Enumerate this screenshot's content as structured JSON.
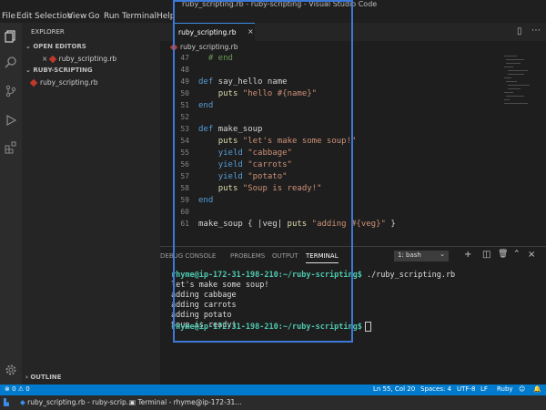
{
  "window": {
    "title": "ruby_scripting.rb - ruby-scripting - Visual Studio Code"
  },
  "menu": [
    "File",
    "Edit",
    "Selection",
    "View",
    "Go",
    "Run",
    "Terminal",
    "Help"
  ],
  "sidebar": {
    "explorer_label": "EXPLORER",
    "open_editors_label": "OPEN EDITORS",
    "open_editor_file": "ruby_scripting.rb",
    "folder_label": "RUBY-SCRIPTING",
    "folder_file": "ruby_scripting.rb",
    "outline_label": "OUTLINE"
  },
  "editor": {
    "tab_label": "ruby_scripting.rb",
    "breadcrumb": "ruby_scripting.rb",
    "lines": [
      {
        "num": "47",
        "text": "  # end"
      },
      {
        "num": "48",
        "text": ""
      },
      {
        "num": "49",
        "text": "def say_hello name"
      },
      {
        "num": "50",
        "text": "    puts \"hello #{name}\""
      },
      {
        "num": "51",
        "text": "end"
      },
      {
        "num": "52",
        "text": ""
      },
      {
        "num": "53",
        "text": "def make_soup"
      },
      {
        "num": "54",
        "text": "    puts \"let's make some soup!\""
      },
      {
        "num": "55",
        "text": "    yield \"cabbage\""
      },
      {
        "num": "56",
        "text": "    yield \"carrots\""
      },
      {
        "num": "57",
        "text": "    yield \"potato\""
      },
      {
        "num": "58",
        "text": "    puts \"Soup is ready!\""
      },
      {
        "num": "59",
        "text": "end"
      },
      {
        "num": "60",
        "text": ""
      },
      {
        "num": "61",
        "text": "make_soup { |veg| puts \"adding #{veg}\" }"
      }
    ]
  },
  "panel": {
    "tabs": [
      "DEBUG CONSOLE",
      "PROBLEMS",
      "OUTPUT",
      "TERMINAL"
    ],
    "active_tab": "TERMINAL",
    "shell_selector": "1: bash",
    "terminal": {
      "prompt": "rhyme@ip-172-31-198-210:~/ruby-scripting$",
      "command": " ./ruby_scripting.rb",
      "output": [
        "let's make some soup!",
        "adding cabbage",
        "adding carrots",
        "adding potato",
        "Soup is ready!"
      ]
    }
  },
  "statusbar": {
    "position": "Ln 55, Col 20",
    "spaces": "Spaces: 4",
    "encoding": "UTF-8",
    "eol": "LF",
    "language": "Ruby"
  },
  "taskbar": {
    "item1": "ruby_scripting.rb - ruby-scrip...",
    "item2": "Terminal - rhyme@ip-172-31..."
  },
  "colors": {
    "accent": "#007acc",
    "highlight_border": "#3c78d8"
  }
}
